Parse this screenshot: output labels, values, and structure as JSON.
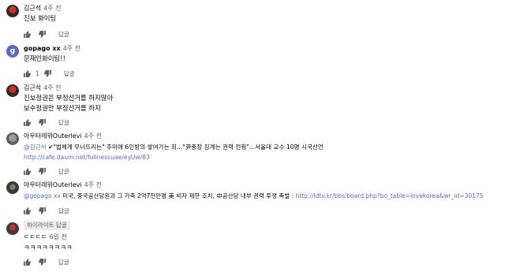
{
  "comments": [
    {
      "author": "김근석",
      "time": "4주 전",
      "lines": [
        "진보 화이팅"
      ],
      "likes": "",
      "reply": "답글"
    },
    {
      "author": "gopago xx",
      "time": "4주 전",
      "avatar_letter": "g",
      "lines": [
        "문재인화이팅!!"
      ],
      "likes": "1",
      "reply": "답글"
    },
    {
      "author": "김근석",
      "time": "4주 전",
      "lines": [
        "진보정권은 부정선거를 하지않아",
        "보수정권만 부정선거를 하지"
      ],
      "likes": "",
      "reply": "답글"
    },
    {
      "author": "아우터레위Outerlevi",
      "time": "4주 전",
      "mention": "@김근석",
      "line1_rest": " ✔\"법체계 무너뜨리는\" 추미애 6인방의 쌓여가는 죄...\"尹총장 징계는 권력 전횡\"...서울대 교수 10명 시국선언",
      "link": "http://cafe.daum.net/fullnessuae/eyUw/83",
      "likes": "",
      "reply": "답글"
    },
    {
      "author": "아우터레위Outerlevi",
      "time": "4주 전",
      "mention": "@gopago xx",
      "line1_rest": " 미국, 중국공산당원과 그 가족 2억7천만명 美 비자 제한 조치, 中공산당 내부 권력 투쟁 촉발 : ",
      "link": "http://ldtv.kr/bbs/board.php?bo_table=lovekorea&wr_id=30175",
      "likes": "",
      "reply": "답글"
    },
    {
      "badge": "하이라이트 답글",
      "author": "ㄷㄷㄷㄷ",
      "time": "6일 전",
      "lines": [
        "ㅋㅋㅋㅋㅋㅋㅋㅋ"
      ],
      "likes": "",
      "reply": "답글"
    }
  ],
  "icons": {
    "like": "thumb-up-icon",
    "dislike": "thumb-down-icon"
  }
}
